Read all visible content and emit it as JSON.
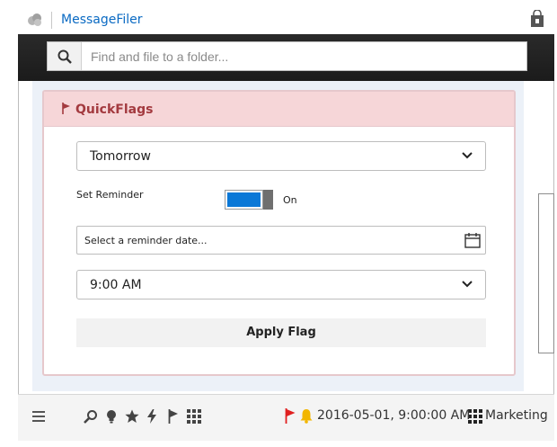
{
  "app": {
    "title": "MessageFiler"
  },
  "search": {
    "placeholder": "Find and file to a folder..."
  },
  "quickflags": {
    "title": "QuickFlags",
    "due_select": {
      "selected": "Tomorrow"
    },
    "reminder": {
      "label": "Set Reminder",
      "enabled": true,
      "state_label": "On"
    },
    "reminder_date": {
      "placeholder": "Select a reminder date..."
    },
    "time_select": {
      "selected": "9:00 AM"
    },
    "apply_label": "Apply Flag"
  },
  "footer": {
    "toolbar_icons": [
      "menu-icon",
      "search-icon",
      "bulb-icon",
      "star-icon",
      "lightning-icon",
      "flag-icon",
      "grid-icon"
    ],
    "status": {
      "text": "2016-05-01, 9:00:00 AM",
      "flag_color": "#e02020",
      "bell_color": "#f2b600"
    },
    "folder": {
      "name": "Marketing"
    }
  },
  "colors": {
    "accent": "#0a6ac3",
    "toggle_on": "#0a78d7",
    "card_header_bg": "#f6d6d8",
    "card_title": "#a33a3f"
  }
}
